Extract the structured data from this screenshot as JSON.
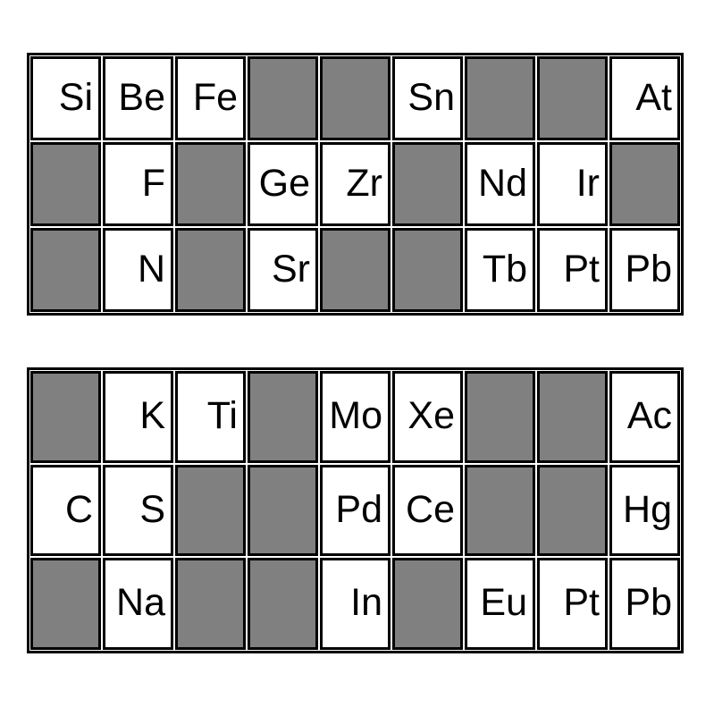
{
  "page": {
    "background_color": "#ffffff",
    "empty_cell_color": "#808080",
    "filled_cell_color": "#ffffff",
    "border_color": "#000000",
    "text_color": "#000000"
  },
  "grids": [
    {
      "id": "grid-1",
      "columns": 9,
      "rows": 3,
      "cells": [
        [
          {
            "label": "Si",
            "empty": false
          },
          {
            "label": "Be",
            "empty": false
          },
          {
            "label": "Fe",
            "empty": false
          },
          {
            "label": "",
            "empty": true
          },
          {
            "label": "",
            "empty": true
          },
          {
            "label": "Sn",
            "empty": false
          },
          {
            "label": "",
            "empty": true
          },
          {
            "label": "",
            "empty": true
          },
          {
            "label": "At",
            "empty": false
          }
        ],
        [
          {
            "label": "",
            "empty": true
          },
          {
            "label": "F",
            "empty": false
          },
          {
            "label": "",
            "empty": true
          },
          {
            "label": "Ge",
            "empty": false
          },
          {
            "label": "Zr",
            "empty": false
          },
          {
            "label": "",
            "empty": true
          },
          {
            "label": "Nd",
            "empty": false
          },
          {
            "label": "Ir",
            "empty": false
          },
          {
            "label": "",
            "empty": true
          }
        ],
        [
          {
            "label": "",
            "empty": true
          },
          {
            "label": "N",
            "empty": false
          },
          {
            "label": "",
            "empty": true
          },
          {
            "label": "Sr",
            "empty": false
          },
          {
            "label": "",
            "empty": true
          },
          {
            "label": "",
            "empty": true
          },
          {
            "label": "Tb",
            "empty": false
          },
          {
            "label": "Pt",
            "empty": false
          },
          {
            "label": "Pb",
            "empty": false
          }
        ]
      ]
    },
    {
      "id": "grid-2",
      "columns": 9,
      "rows": 3,
      "cells": [
        [
          {
            "label": "",
            "empty": true
          },
          {
            "label": "K",
            "empty": false
          },
          {
            "label": "Ti",
            "empty": false
          },
          {
            "label": "",
            "empty": true
          },
          {
            "label": "Mo",
            "empty": false
          },
          {
            "label": "Xe",
            "empty": false
          },
          {
            "label": "",
            "empty": true
          },
          {
            "label": "",
            "empty": true
          },
          {
            "label": "Ac",
            "empty": false
          }
        ],
        [
          {
            "label": "C",
            "empty": false
          },
          {
            "label": "S",
            "empty": false
          },
          {
            "label": "",
            "empty": true
          },
          {
            "label": "",
            "empty": true
          },
          {
            "label": "Pd",
            "empty": false
          },
          {
            "label": "Ce",
            "empty": false
          },
          {
            "label": "",
            "empty": true
          },
          {
            "label": "",
            "empty": true
          },
          {
            "label": "Hg",
            "empty": false
          }
        ],
        [
          {
            "label": "",
            "empty": true
          },
          {
            "label": "Na",
            "empty": false
          },
          {
            "label": "",
            "empty": true
          },
          {
            "label": "",
            "empty": true
          },
          {
            "label": "In",
            "empty": false
          },
          {
            "label": "",
            "empty": true
          },
          {
            "label": "Eu",
            "empty": false
          },
          {
            "label": "Pt",
            "empty": false
          },
          {
            "label": "Pb",
            "empty": false
          }
        ]
      ]
    }
  ]
}
